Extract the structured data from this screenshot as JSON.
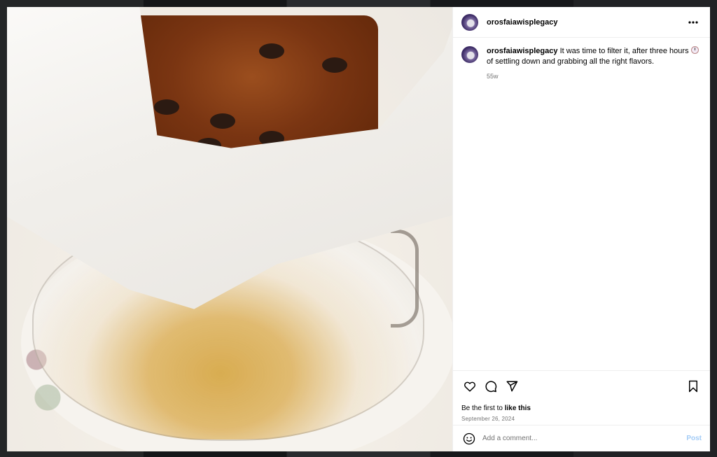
{
  "post": {
    "username": "orosfaiawisplegacy",
    "caption_before": "It was time to filter it, after three hours",
    "caption_emoji_icon": "clock-icon",
    "caption_after": "of settling down and grabbing all the right flavors.",
    "caption_age": "55w",
    "likes_prefix": "Be the first to",
    "likes_link": "like this",
    "date": "September 26, 2024"
  },
  "comment": {
    "placeholder": "Add a comment...",
    "post_label": "Post"
  },
  "icons": {
    "more": "more-options-icon",
    "like": "heart-icon",
    "comment": "comment-icon",
    "share": "send-icon",
    "save": "bookmark-icon",
    "emoji": "emoji-icon"
  },
  "colors": {
    "post_button": "#a2cbf6",
    "muted_text": "#737373"
  }
}
